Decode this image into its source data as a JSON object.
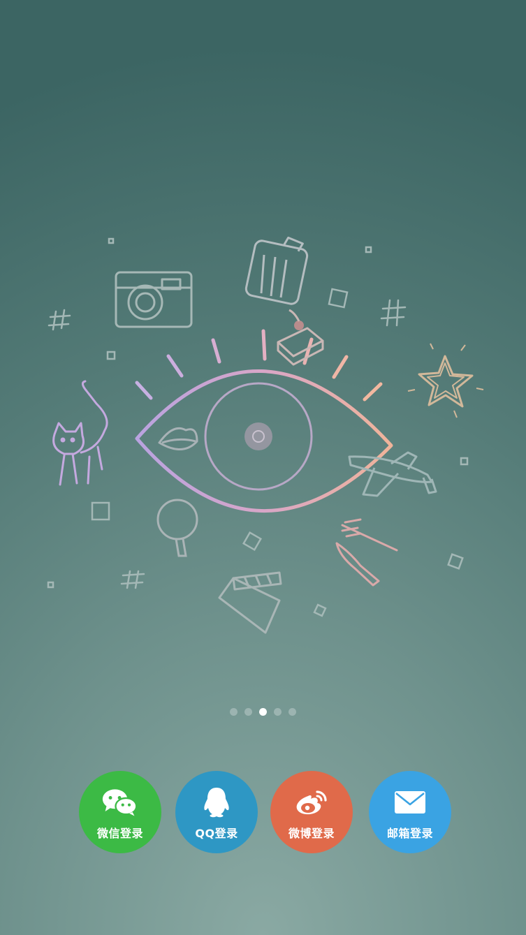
{
  "pager": {
    "count": 5,
    "active_index": 2
  },
  "login": {
    "wechat": {
      "label": "微信登录",
      "color": "#3cba45",
      "icon": "wechat-icon"
    },
    "qq": {
      "label": "QQ登录",
      "color": "#2e97c4",
      "icon": "qq-penguin-icon"
    },
    "weibo": {
      "label": "微博登录",
      "color": "#e06a4a",
      "icon": "weibo-icon"
    },
    "email": {
      "label": "邮箱登录",
      "color": "#3aa3e3",
      "icon": "envelope-icon"
    }
  }
}
